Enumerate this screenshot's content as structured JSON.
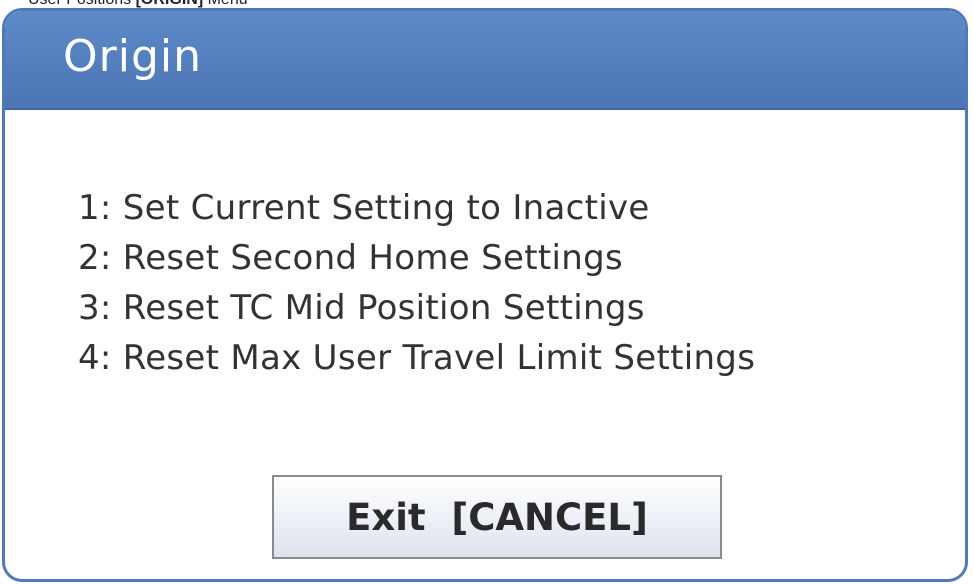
{
  "caption": {
    "prefix": "User Positions ",
    "key": "[ORIGIN]",
    "suffix": " Menu"
  },
  "dialog": {
    "title": "Origin",
    "options": [
      "1: Set Current Setting to Inactive",
      "2: Reset Second Home Settings",
      "3: Reset TC Mid Position Settings",
      "4: Reset Max User Travel Limit Settings"
    ],
    "exit_button_label": "Exit  [CANCEL]"
  },
  "colors": {
    "title_bar": "#5581c0",
    "border": "#4f79b7",
    "text": "#333333",
    "background": "#ffffff"
  }
}
